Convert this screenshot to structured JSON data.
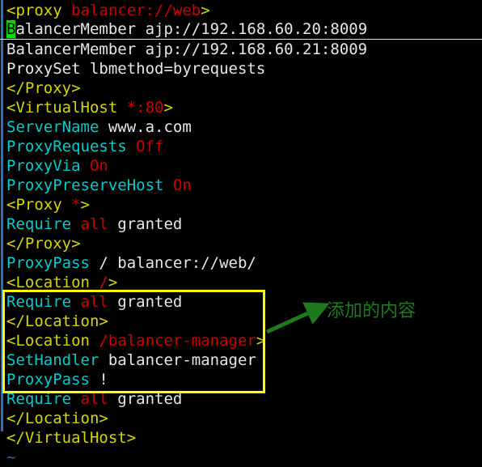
{
  "terminal": {
    "app": "vim",
    "background_color": "#000000",
    "foreground_color": "#e6e6e6",
    "colors": {
      "tag_yellow": "#d7d700",
      "directive_cyan": "#00cdcd",
      "value_red": "#cd0000",
      "plain_white": "#e6e6e6",
      "tilde_blue": "#2a6fba",
      "cursor_green": "#00e000",
      "annotation_yellow": "#ffff00",
      "annotation_green": "#1d7a1d"
    },
    "left_border": "vim-split-border"
  },
  "lines": [
    {
      "id": "line-1",
      "cursorline": false,
      "spans": [
        {
          "t": "<proxy ",
          "c": "tag"
        },
        {
          "t": "balancer://web",
          "c": "val"
        },
        {
          "t": ">",
          "c": "tag"
        }
      ]
    },
    {
      "id": "line-2",
      "cursorline": true,
      "spans": [
        {
          "t": "B",
          "c": "cursor"
        },
        {
          "t": "alancerMember ajp://192.168.60.20:8009",
          "c": "txt"
        }
      ]
    },
    {
      "id": "line-3",
      "cursorline": false,
      "spans": [
        {
          "t": "BalancerMember ajp://192.168.60.21:8009",
          "c": "txt"
        }
      ]
    },
    {
      "id": "line-4",
      "cursorline": false,
      "spans": [
        {
          "t": "ProxySet lbmethod=byrequests",
          "c": "txt"
        }
      ]
    },
    {
      "id": "line-5",
      "cursorline": false,
      "spans": [
        {
          "t": "</Proxy>",
          "c": "tag"
        }
      ]
    },
    {
      "id": "line-6",
      "cursorline": false,
      "spans": [
        {
          "t": "<VirtualHost ",
          "c": "tag"
        },
        {
          "t": "*:80",
          "c": "val"
        },
        {
          "t": ">",
          "c": "tag"
        }
      ]
    },
    {
      "id": "line-7",
      "cursorline": false,
      "spans": [
        {
          "t": "ServerName",
          "c": "dir"
        },
        {
          "t": " www.a.com",
          "c": "txt"
        }
      ]
    },
    {
      "id": "line-8",
      "cursorline": false,
      "spans": [
        {
          "t": "ProxyRequests",
          "c": "dir"
        },
        {
          "t": " ",
          "c": "txt"
        },
        {
          "t": "Off",
          "c": "val"
        }
      ]
    },
    {
      "id": "line-9",
      "cursorline": false,
      "spans": [
        {
          "t": "ProxyVia",
          "c": "dir"
        },
        {
          "t": " ",
          "c": "txt"
        },
        {
          "t": "On",
          "c": "val"
        }
      ]
    },
    {
      "id": "line-10",
      "cursorline": false,
      "spans": [
        {
          "t": "ProxyPreserveHost",
          "c": "dir"
        },
        {
          "t": " ",
          "c": "txt"
        },
        {
          "t": "On",
          "c": "val"
        }
      ]
    },
    {
      "id": "line-11",
      "cursorline": false,
      "spans": [
        {
          "t": "<Proxy ",
          "c": "tag"
        },
        {
          "t": "*",
          "c": "val"
        },
        {
          "t": ">",
          "c": "tag"
        }
      ]
    },
    {
      "id": "line-12",
      "cursorline": false,
      "spans": [
        {
          "t": "Require",
          "c": "dir"
        },
        {
          "t": " ",
          "c": "txt"
        },
        {
          "t": "all",
          "c": "val"
        },
        {
          "t": " granted",
          "c": "txt"
        }
      ]
    },
    {
      "id": "line-13",
      "cursorline": false,
      "spans": [
        {
          "t": "</Proxy>",
          "c": "tag"
        }
      ]
    },
    {
      "id": "line-14",
      "cursorline": false,
      "spans": [
        {
          "t": "ProxyPass",
          "c": "dir"
        },
        {
          "t": " / balancer://web/",
          "c": "txt"
        }
      ]
    },
    {
      "id": "line-15",
      "cursorline": false,
      "spans": [
        {
          "t": "<Location ",
          "c": "tag"
        },
        {
          "t": "/",
          "c": "val"
        },
        {
          "t": ">",
          "c": "tag"
        }
      ]
    },
    {
      "id": "line-16",
      "cursorline": false,
      "spans": [
        {
          "t": "Require",
          "c": "dir"
        },
        {
          "t": " ",
          "c": "txt"
        },
        {
          "t": "all",
          "c": "val"
        },
        {
          "t": " granted",
          "c": "txt"
        }
      ]
    },
    {
      "id": "line-17",
      "cursorline": false,
      "spans": [
        {
          "t": "</Location>",
          "c": "tag"
        }
      ]
    },
    {
      "id": "line-18",
      "cursorline": false,
      "spans": [
        {
          "t": "<Location ",
          "c": "tag"
        },
        {
          "t": "/balancer-manager",
          "c": "val"
        },
        {
          "t": ">",
          "c": "tag"
        }
      ]
    },
    {
      "id": "line-19",
      "cursorline": false,
      "spans": [
        {
          "t": "SetHandler",
          "c": "dir"
        },
        {
          "t": " balancer-manager",
          "c": "txt"
        }
      ]
    },
    {
      "id": "line-20",
      "cursorline": false,
      "spans": [
        {
          "t": "ProxyPass",
          "c": "dir"
        },
        {
          "t": " !",
          "c": "txt"
        }
      ]
    },
    {
      "id": "line-21",
      "cursorline": false,
      "spans": [
        {
          "t": "Require",
          "c": "dir"
        },
        {
          "t": " ",
          "c": "txt"
        },
        {
          "t": "all",
          "c": "val"
        },
        {
          "t": " granted",
          "c": "txt"
        }
      ]
    },
    {
      "id": "line-22",
      "cursorline": false,
      "spans": [
        {
          "t": "</Location>",
          "c": "tag"
        }
      ]
    },
    {
      "id": "line-23",
      "cursorline": false,
      "spans": [
        {
          "t": "</VirtualHost>",
          "c": "tag"
        }
      ]
    },
    {
      "id": "line-24",
      "cursorline": false,
      "spans": [
        {
          "t": "~",
          "c": "tilde"
        }
      ]
    }
  ],
  "annotation": {
    "label": "添加的内容",
    "box_covers_lines": [
      17,
      18,
      19,
      20,
      21,
      22
    ],
    "arrow": "arrow-pointing-up-right"
  }
}
